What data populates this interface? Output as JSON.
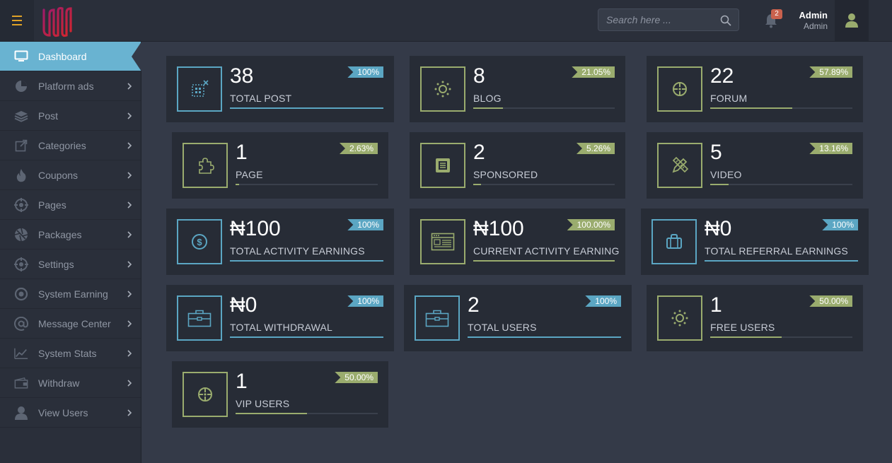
{
  "header": {
    "search_placeholder": "Search here ...",
    "notification_count": "2",
    "user_name": "Admin",
    "user_role": "Admin"
  },
  "sidebar": {
    "items": [
      {
        "label": "Dashboard",
        "icon": "monitor-icon"
      },
      {
        "label": "Platform ads",
        "icon": "pie-chart-icon"
      },
      {
        "label": "Post",
        "icon": "layers-icon"
      },
      {
        "label": "Categories",
        "icon": "external-square-icon"
      },
      {
        "label": "Coupons",
        "icon": "flame-icon"
      },
      {
        "label": "Pages",
        "icon": "target-icon"
      },
      {
        "label": "Packages",
        "icon": "aperture-icon"
      },
      {
        "label": "Settings",
        "icon": "target-icon"
      },
      {
        "label": "System Earning",
        "icon": "circle-dot-icon"
      },
      {
        "label": "Message Center",
        "icon": "at-icon"
      },
      {
        "label": "System Stats",
        "icon": "trend-icon"
      },
      {
        "label": "Withdraw",
        "icon": "wallet-icon"
      },
      {
        "label": "View Users",
        "icon": "user-icon"
      }
    ]
  },
  "colors": {
    "accent_blue": "#5ba6c3",
    "accent_green": "#9aac6e",
    "active_nav": "#69b3d1",
    "menu_icon": "#e0a227",
    "badge": "#c9614d"
  },
  "cards": [
    {
      "value": "38",
      "label": "TOTAL POST",
      "percent": "100%",
      "progress": 1.0,
      "color": "blue",
      "icon": "dotted-select-icon"
    },
    {
      "value": "8",
      "label": "BLOG",
      "percent": "21.05%",
      "progress": 0.2105,
      "color": "green",
      "icon": "sun-icon"
    },
    {
      "value": "22",
      "label": "FORUM",
      "percent": "57.89%",
      "progress": 0.5789,
      "color": "green",
      "icon": "crosshair-icon"
    },
    {
      "value": "1",
      "label": "PAGE",
      "percent": "2.63%",
      "progress": 0.0263,
      "color": "green",
      "icon": "puzzle-icon"
    },
    {
      "value": "2",
      "label": "SPONSORED",
      "percent": "5.26%",
      "progress": 0.0526,
      "color": "green",
      "icon": "document-icon"
    },
    {
      "value": "5",
      "label": "VIDEO",
      "percent": "13.16%",
      "progress": 0.1316,
      "color": "green",
      "icon": "pencil-ruler-icon"
    },
    {
      "value": "₦100",
      "label": "TOTAL ACTIVITY EARNINGS",
      "percent": "100%",
      "progress": 1.0,
      "color": "blue",
      "icon": "dollar-circle-icon"
    },
    {
      "value": "₦100",
      "label": "CURRENT ACTIVITY EARNING",
      "percent": "100.00%",
      "progress": 1.0,
      "color": "green",
      "icon": "browser-window-icon"
    },
    {
      "value": "₦0",
      "label": "TOTAL REFERRAL EARNINGS",
      "percent": "100%",
      "progress": 1.0,
      "color": "blue",
      "icon": "bag-icon"
    },
    {
      "value": "₦0",
      "label": "TOTAL WITHDRAWAL",
      "percent": "100%",
      "progress": 1.0,
      "color": "blue",
      "icon": "briefcase-icon"
    },
    {
      "value": "2",
      "label": "TOTAL USERS",
      "percent": "100%",
      "progress": 1.0,
      "color": "blue",
      "icon": "briefcase-icon"
    },
    {
      "value": "1",
      "label": "FREE USERS",
      "percent": "50.00%",
      "progress": 0.5,
      "color": "green",
      "icon": "sun-icon"
    },
    {
      "value": "1",
      "label": "VIP USERS",
      "percent": "50.00%",
      "progress": 0.5,
      "color": "green",
      "icon": "crosshair-icon"
    }
  ]
}
